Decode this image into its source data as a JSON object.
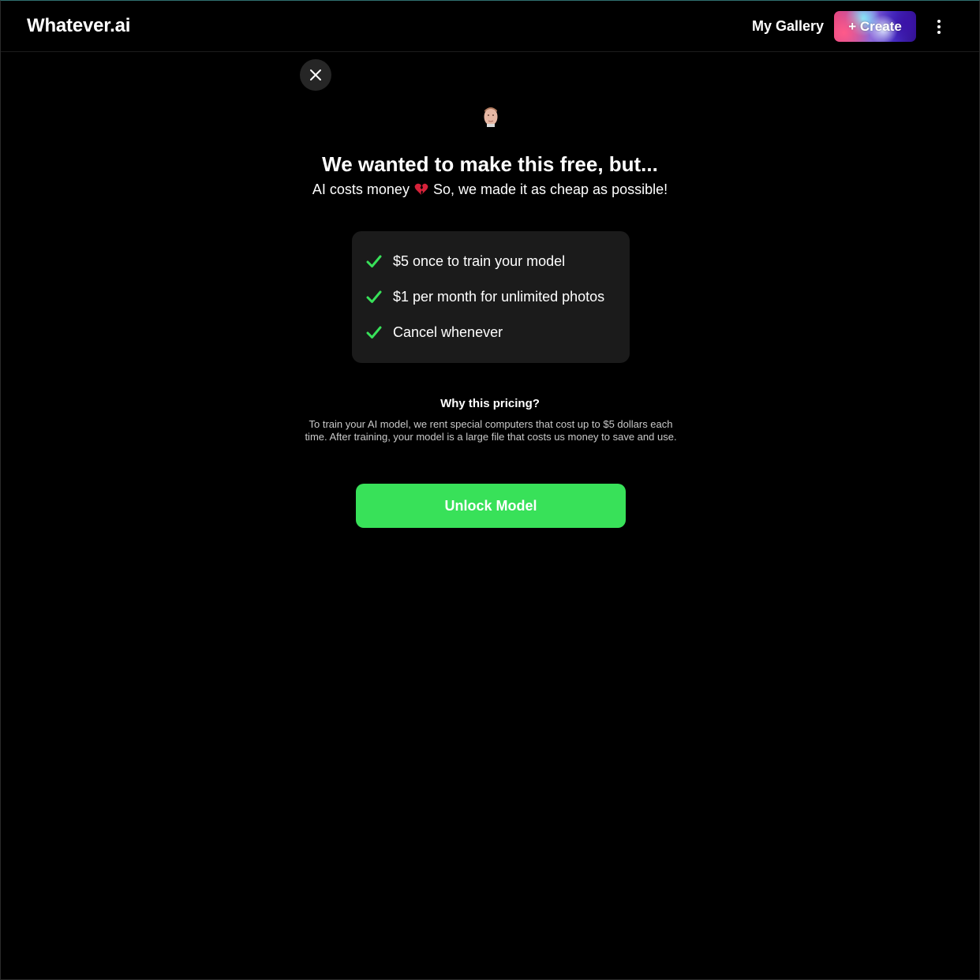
{
  "header": {
    "logo": "Whatever.ai",
    "gallery_label": "My Gallery",
    "create_label": "+ Create",
    "menu_icon": "kebab-menu-icon"
  },
  "modal": {
    "close_icon": "close-icon",
    "avatar_icon": "avatar",
    "headline": "We wanted to make this free, but...",
    "subline_before": "AI costs money",
    "subline_emoji": "broken-heart-icon",
    "subline_after": "So, we made it as cheap as possible!",
    "features": [
      {
        "icon": "check-icon",
        "text": "$5 once to train your model"
      },
      {
        "icon": "check-icon",
        "text": "$1 per month for unlimited photos"
      },
      {
        "icon": "check-icon",
        "text": "Cancel whenever"
      }
    ],
    "why_title": "Why this pricing?",
    "why_text": "To train your AI model, we rent special computers that cost up to $5 dollars each time. After training, your model is a large file that costs us money to save and use.",
    "unlock_label": "Unlock Model"
  },
  "colors": {
    "background": "#000000",
    "card": "#1b1b1b",
    "accent_green": "#38e159",
    "check_green": "#38e159",
    "heart_red": "#d6223a"
  }
}
